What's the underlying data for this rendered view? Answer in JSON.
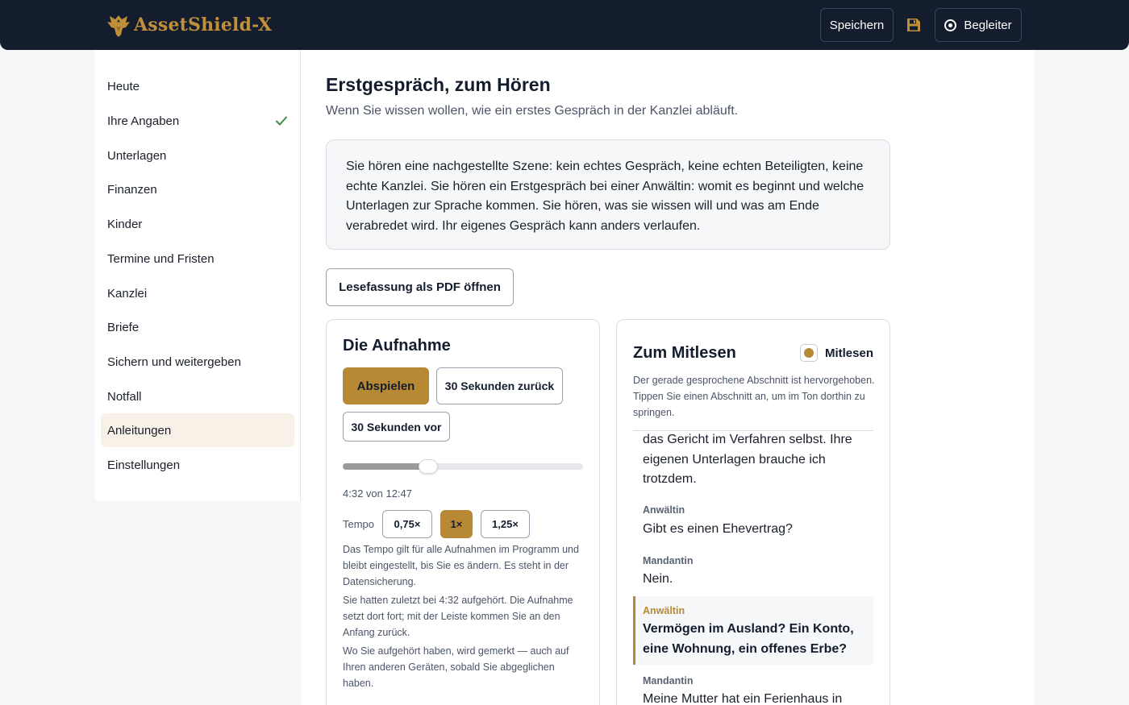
{
  "header": {
    "brand": "AssetShield-X",
    "save_label": "Speichern",
    "companion_label": "Begleiter",
    "colors": {
      "bar": "#141d2e",
      "brand": "#c08f3a"
    },
    "icons": [
      "eagle-logo-icon",
      "floppy-disk-icon",
      "companion-ring-icon"
    ]
  },
  "sidebar": {
    "items": [
      {
        "label": "Heute"
      },
      {
        "label": "Ihre Angaben",
        "status": "checked"
      },
      {
        "label": "Unterlagen"
      },
      {
        "label": "Finanzen"
      },
      {
        "label": "Kinder"
      },
      {
        "label": "Termine und Fristen"
      },
      {
        "label": "Kanzlei"
      },
      {
        "label": "Briefe"
      },
      {
        "label": "Sichern und weitergeben"
      },
      {
        "label": "Notfall"
      },
      {
        "label": "Anleitungen",
        "active": true
      },
      {
        "label": "Einstellungen"
      }
    ]
  },
  "main": {
    "title": "Erstgespräch, zum Hören",
    "subtitle": "Wenn Sie wissen wollen, wie ein erstes Gespräch in der Kanzlei abläuft.",
    "intro": "Sie hören eine nachgestellte Szene: kein echtes Gespräch, keine echten Beteiligten, keine echte Kanzlei. Sie hören ein Erstgespräch bei einer Anwältin: womit es beginnt und welche Unterlagen zur Sprache kommen. Sie hören, was sie wissen will und was am Ende verabredet wird. Ihr eigenes Gespräch kann anders verlaufen.",
    "pdf_button": "Lesefassung als PDF öffnen"
  },
  "player": {
    "title": "Die Aufnahme",
    "play": "Abspielen",
    "back": "30 Sekunden zurück",
    "forward": "30 Sekunden vor",
    "progress": 0.356,
    "time": "4:32 von 12:47",
    "tempo_label": "Tempo",
    "speeds": [
      "0,75×",
      "1×",
      "1,25×"
    ],
    "selected_speed": "1×",
    "accent": "#b88934",
    "note_tempo": "Das Tempo gilt für alle Aufnahmen im Programm und bleibt eingestellt, bis Sie es ändern. Es steht in der Datensicherung.",
    "note_resume": "Sie hatten zuletzt bei 4:32 aufgehört. Die Aufnahme setzt dort fort; mit der Leiste kommen Sie an den Anfang zurück.",
    "note_sync": "Wo Sie aufgehört haben, wird gemerkt — auch auf Ihren anderen Geräten, sobald Sie abgeglichen haben."
  },
  "readalong": {
    "title": "Zum Mitlesen",
    "toggle_label": "Mitlesen",
    "toggle_on": true,
    "description": "Der gerade gesprochene Abschnitt ist hervorgehoben. Tippen Sie einen Abschnitt an, um im Ton dorthin zu springen.",
    "segments": [
      {
        "speaker": "",
        "text": "das Gericht im Verfahren selbst. Ihre eigenen Unterlagen brauche ich trotzdem."
      },
      {
        "speaker": "Anwältin",
        "text": "Gibt es einen Ehevertrag?"
      },
      {
        "speaker": "Mandantin",
        "text": "Nein."
      },
      {
        "speaker": "Anwältin",
        "text": "Vermögen im Ausland? Ein Konto, eine Wohnung, ein offenes Erbe?",
        "current": true
      },
      {
        "speaker": "Mandantin",
        "text": "Meine Mutter hat ein Ferienhaus in"
      }
    ]
  }
}
